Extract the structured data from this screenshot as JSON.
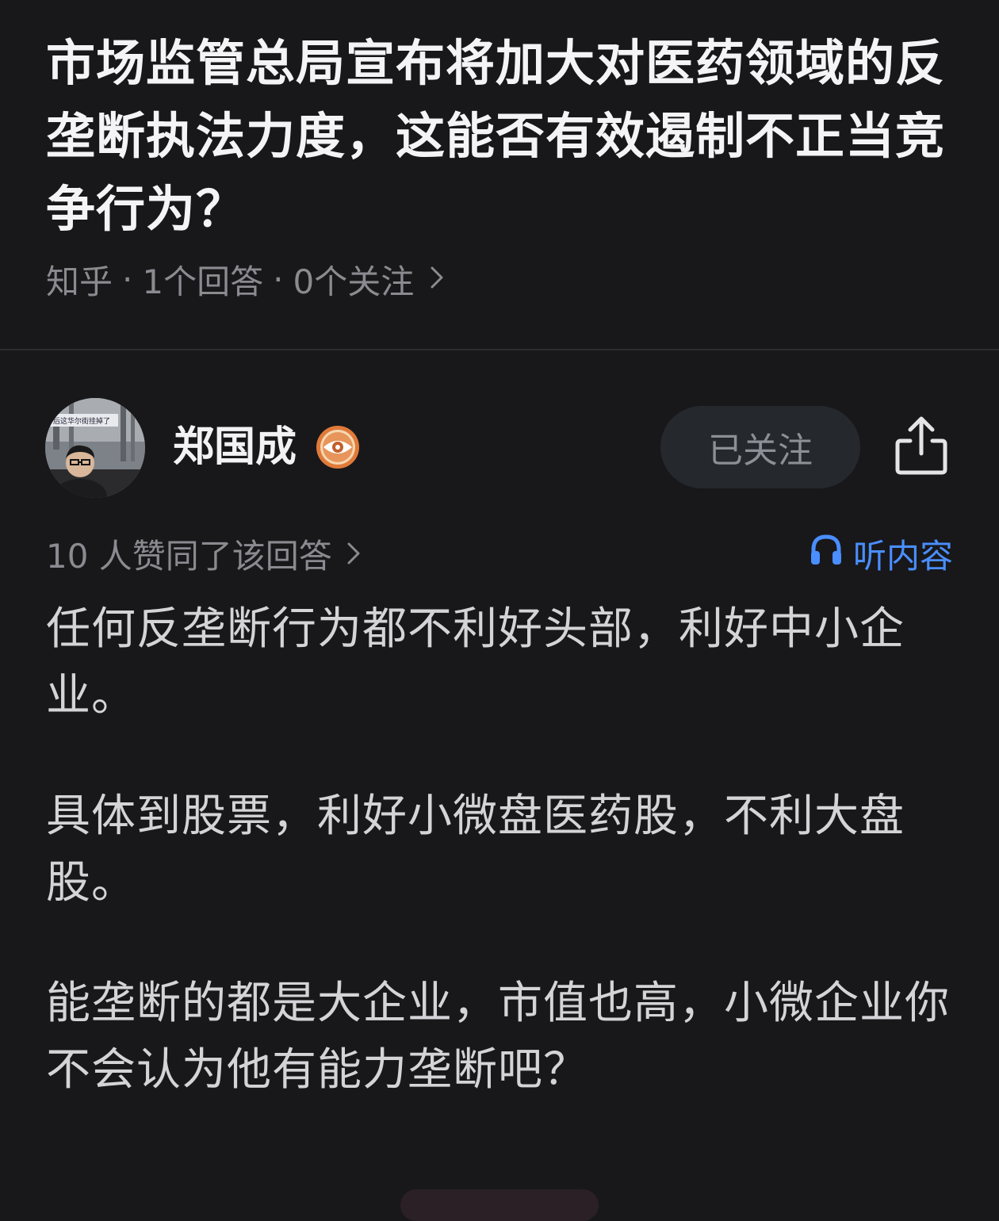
{
  "question": {
    "title": "市场监管总局宣布将加大对医药领域的反垄断执法力度，这能否有效遏制不正当竞争行为？",
    "source": "知乎",
    "answers": "1个回答",
    "follows": "0个关注",
    "separator": "·"
  },
  "author": {
    "name": "郑国成",
    "avatar_caption": "后这华尔街挂掉了",
    "follow_label": "已关注"
  },
  "answer_meta": {
    "votes": "10 人赞同了该回答",
    "listen_label": "听内容"
  },
  "answer": {
    "paragraphs": [
      "任何反垄断行为都不利好头部，利好中小企业。",
      "具体到股票，利好小微盘医药股，不利大盘股。",
      "能垄断的都是大企业，市值也高，小微企业你不会认为他有能力垄断吧？"
    ]
  },
  "icons": {
    "chevron": "chevron-right-icon",
    "share": "share-icon",
    "headphones": "headphones-icon",
    "badge": "eye-badge-icon"
  },
  "colors": {
    "background": "#18181a",
    "title": "#f4f4f6",
    "body_text": "#d4d4d8",
    "muted": "#8a8a90",
    "accent": "#4a8eff",
    "button_bg": "#25282d"
  }
}
